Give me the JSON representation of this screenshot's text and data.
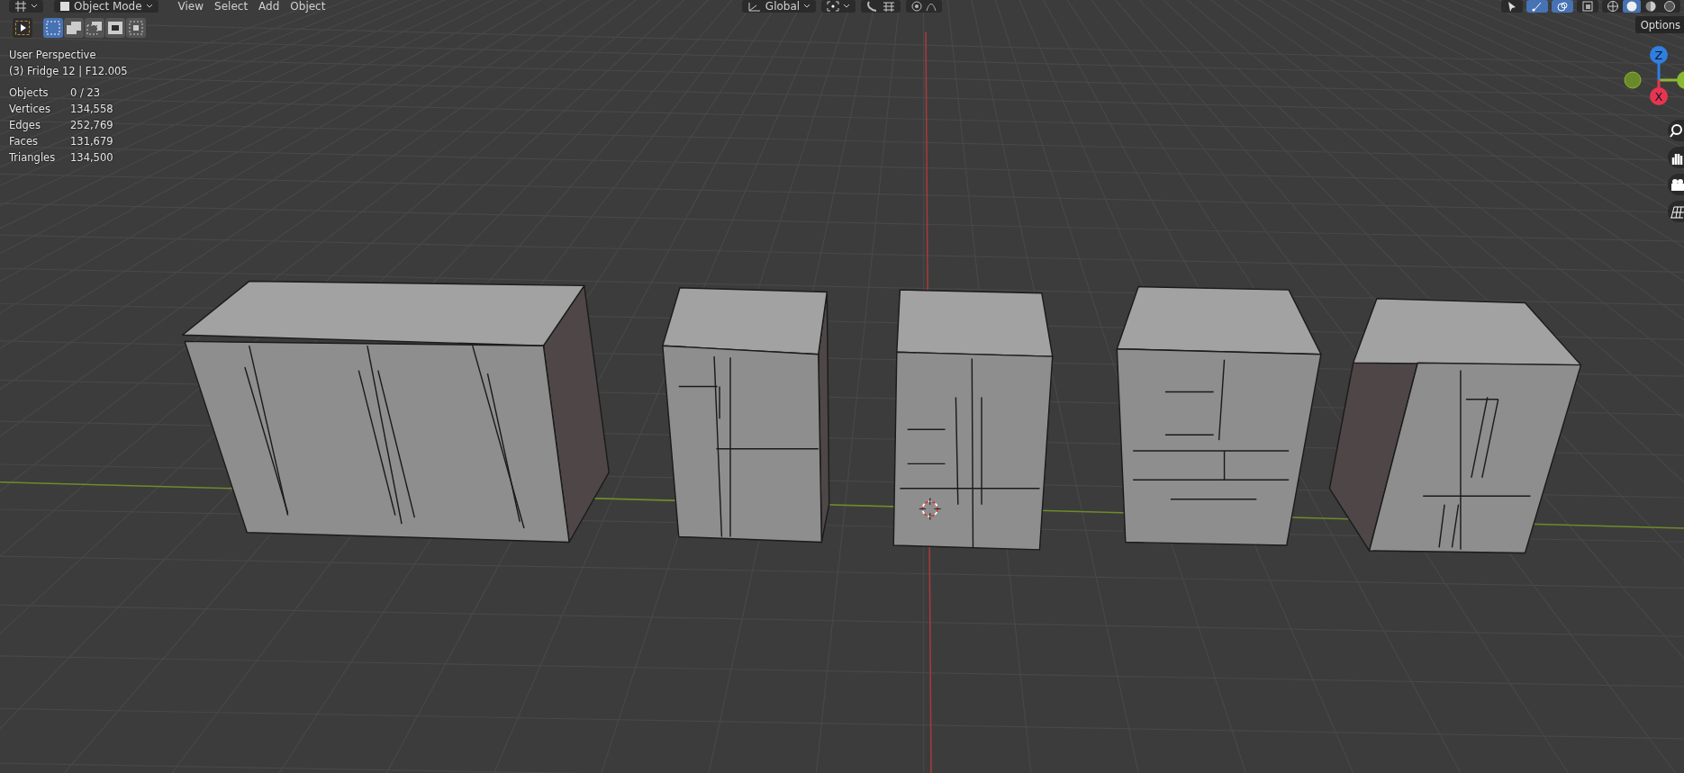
{
  "header": {
    "mode": "Object Mode",
    "menus": [
      "View",
      "Select",
      "Add",
      "Object"
    ],
    "orientation": "Global",
    "gizmos_on": true,
    "overlays_on": true,
    "xray_on": false,
    "shading_modes": [
      {
        "selected": false
      },
      {
        "selected": true
      },
      {
        "selected": false
      },
      {
        "selected": false
      }
    ]
  },
  "toolbar": {
    "select_tool": {
      "selected": true
    },
    "select_modes": [
      {
        "selected": true
      },
      {
        "selected": false
      },
      {
        "selected": false
      },
      {
        "selected": false
      },
      {
        "selected": false
      }
    ]
  },
  "overlay": {
    "view_name": "User Perspective",
    "object_info": "(3) Fridge 12 | F12.005",
    "stats": [
      {
        "label": "Objects",
        "value": "0 / 23"
      },
      {
        "label": "Vertices",
        "value": "134,558"
      },
      {
        "label": "Edges",
        "value": "252,769"
      },
      {
        "label": "Faces",
        "value": "131,679"
      },
      {
        "label": "Triangles",
        "value": "134,500"
      }
    ]
  },
  "options_button": "Options",
  "gizmo": {
    "axes": [
      {
        "label": "Z",
        "color": "#2f7fe0"
      },
      {
        "label": "X",
        "color": "#e8354f"
      }
    ]
  }
}
